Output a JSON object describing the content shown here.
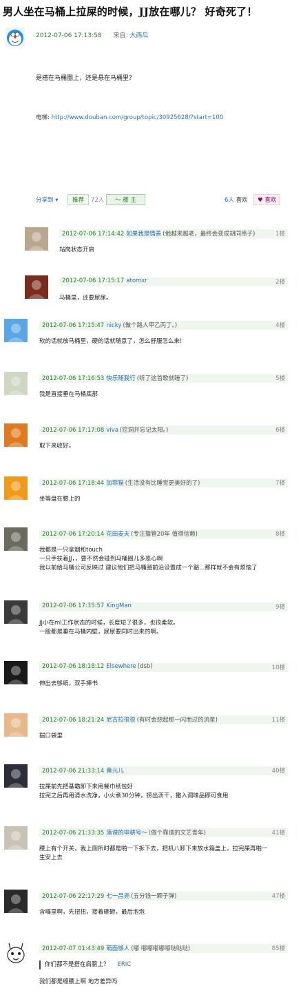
{
  "post": {
    "title": "男人坐在马桶上拉屎的时候，JJ放在哪儿？ 好奇死了！",
    "time": "2012-07-06 17:13:58",
    "from_label": "来自:",
    "author": "大西瓜",
    "body": "是搭在马桶圈上，还是悬在马桶里？",
    "link_label": "电梯:",
    "link_url": "http://www.douban.com/group/topic/30925628/?start=100",
    "share_label": "分享到 ▾",
    "recommend_label": "推荐",
    "recommend_count": "72人",
    "top_label": "～ 楼 主",
    "likes_count": "6人",
    "likes_label": "喜欢",
    "like_button": "♥ 喜欢"
  },
  "replies": [
    {
      "time": "2012-07-06 17:14:42",
      "user": "如果我是情善",
      "sig": "(他越来越老，最终会变成胡同串子)",
      "floor": "1楼",
      "lines": [
        "站岗状态开启"
      ],
      "color": "#b9a88f"
    },
    {
      "time": "2012-07-06 17:15:17",
      "user": "atomxr",
      "sig": "",
      "floor": "2楼",
      "lines": [
        "马桶里，还要尿尿。"
      ],
      "color": "#7a2d1c"
    },
    {
      "time": "2012-07-06 17:15:47",
      "user": "nicky",
      "sig": "(做个路人甲乙丙丁。)",
      "floor": "4楼",
      "lines": [
        "软的话就放马桶里，硬的话就随意了，怎么舒服怎么来!"
      ],
      "color": "#5aa7e6"
    },
    {
      "time": "2012-07-06 17:16:53",
      "user": "快乐随我行",
      "sig": "(听了这首歌就睡了)",
      "floor": "5楼",
      "lines": [
        "我是直接垂在马桶底部"
      ],
      "color": "#cfd6c2"
    },
    {
      "time": "2012-07-06 17:17:08",
      "user": "viva",
      "sig": "(挖洞并忘记太阳。)",
      "floor": "6楼",
      "lines": [
        "取下来收好。"
      ],
      "color": "#e07a1f"
    },
    {
      "time": "2012-07-06 17:18:44",
      "user": "加菲猫",
      "sig": "(生活没有比睡觉更美好的了)",
      "floor": "7楼",
      "lines": [
        "坐等盘在腰上的"
      ],
      "color": "#f09a1c"
    },
    {
      "time": "2012-07-06 17:20:14",
      "user": "花田麦夫",
      "sig": "(专注撸管20年 值得信赖)",
      "floor": "8楼",
      "lines": [
        "我都是一只拿烟和touch",
        "一只手扶着JJ，，要不然会碰到马桶圈儿多恶心啊",
        "我以前给马桶公司反映过 建议他们把马桶圈前沿设置成一个豁...那样就不会有烦恼了"
      ],
      "color": "#6b6b5e"
    },
    {
      "time": "2012-07-06 17:35:57",
      "user": "KingMan",
      "sig": "",
      "floor": "9楼",
      "lines": [
        "JJ小在ml工作状态的时候，长度短了很多，也很柔软。",
        "一般都是垂在马桶内壁，尿尿要同时出来的啊。"
      ],
      "color": "#3a3a3a"
    },
    {
      "time": "2012-07-06 18:18:12",
      "user": "Elsewhere",
      "sig": "(dsb)",
      "floor": "10楼",
      "lines": [
        "伸出去够纸，双手捧书"
      ],
      "color": "#1a1a1a"
    },
    {
      "time": "2012-07-06 18:21:24",
      "user": "尼古拉很很",
      "sig": "(有时会想起那一闪而过的流星)",
      "floor": "11楼",
      "lines": [
        "揣口袋里"
      ],
      "color": "#e7b98a"
    },
    {
      "time": "2012-07-06 21:33:14",
      "user": "黄元儿",
      "sig": "",
      "floor": "40楼",
      "lines": [
        "拉屎前先把基霸卸下来用餐巾纸包好",
        "拉完之后再用清水洗净，小火煮30分钟，捞出沥干，撒入调味品即可食用"
      ],
      "color": "#2d2d3a"
    },
    {
      "time": "2012-07-06 21:33:35",
      "user": "落课的申耕号～",
      "sig": "(做个靠谱的文艺青年)",
      "floor": "41楼",
      "lines": [
        "腰上有个开关，我上厕所时都是啪一下拆下去，把机八卸下来放水箱盖上，拉完屎再啪一",
        "生安上去"
      ],
      "color": "#c9c3b6"
    },
    {
      "time": "2012-07-06 22:17:29",
      "user": "七一昌尧",
      "sig": "(五分钱一颗子弹)",
      "floor": "47楼",
      "lines": [
        "含嘴里啊，先扭扭，接着砸砸，最后泡泡"
      ],
      "color": "#2a2a2a"
    },
    {
      "time": "2012-07-07 01:43:49",
      "user": "萌面够人",
      "sig": "(嘟 嘟嘟嘟嘟嘟哒哒哒)",
      "floor": "85楼",
      "quote": "你们都不是搭在肩膀上？",
      "quote_user": "ERIC",
      "lines": [
        "我们都是缠腰上啊 地方差异吗"
      ],
      "color": "#ffffff"
    }
  ]
}
